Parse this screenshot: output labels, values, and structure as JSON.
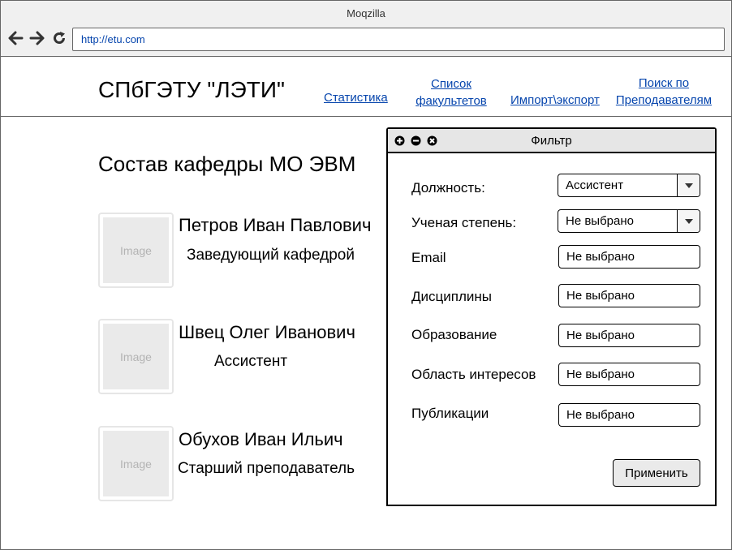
{
  "browser": {
    "title": "Moqzilla",
    "url": "http://etu.com",
    "icons": [
      "back-arrow-icon",
      "forward-arrow-icon",
      "reload-icon"
    ]
  },
  "header": {
    "site_title": "СПбГЭТУ \"ЛЭТИ\"",
    "nav": [
      {
        "lines": [
          "Статистика"
        ]
      },
      {
        "lines": [
          "Список",
          "факультетов"
        ]
      },
      {
        "lines": [
          "Импорт\\экспорт"
        ]
      },
      {
        "lines": [
          "Поиск по",
          "Преподавателям"
        ]
      }
    ]
  },
  "main": {
    "section_title": "Состав кафедры МО ЭВМ",
    "image_placeholder": "Image",
    "people": [
      {
        "name": "Петров Иван Павлович",
        "role": "Заведующий кафедрой"
      },
      {
        "name": "Швец Олег Иванович",
        "role": "Ассистент"
      },
      {
        "name": "Обухов Иван Ильич",
        "role": "Старший преподаватель"
      }
    ]
  },
  "filter": {
    "title": "Фильтр",
    "fields": [
      {
        "label": "Должность:",
        "value": "Ассистент",
        "type": "select"
      },
      {
        "label": "Ученая степень:",
        "value": "Не выбрано",
        "type": "select"
      },
      {
        "label": "Email",
        "value": "Не выбрано",
        "type": "input"
      },
      {
        "label": "Дисциплины",
        "value": "Не выбрано",
        "type": "input"
      },
      {
        "label": "Образование",
        "value": "Не выбрано",
        "type": "input"
      },
      {
        "label": "Область интересов",
        "value": "Не выбрано",
        "type": "input"
      },
      {
        "label": "Публикации",
        "value": "Не выбрано",
        "type": "input"
      }
    ],
    "apply_label": "Применить"
  }
}
